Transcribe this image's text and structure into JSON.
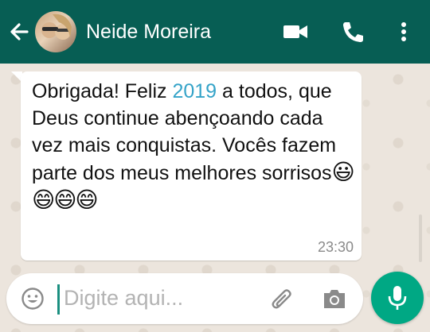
{
  "header": {
    "contact_name": "Neide Moreira",
    "bg_color": "#075e54",
    "icons": [
      "back-arrow-icon",
      "avatar",
      "video-call-icon",
      "phone-icon",
      "more-options-icon"
    ]
  },
  "message": {
    "text_before_year": "Obrigada! Feliz ",
    "year": "2019",
    "text_after_year": " a todos, que Deus continue abençoando cada vez mais conquistas. Vocês fazem parte dos meus melhores sorrisos",
    "emojis": "😃😄😄😄",
    "time": "23:30",
    "year_link_color": "#34a3c8"
  },
  "input": {
    "placeholder": "Digite aqui...",
    "icons": [
      "emoji-icon",
      "attach-clip-icon",
      "camera-icon",
      "mic-icon"
    ],
    "send_button_color": "#00a884"
  }
}
